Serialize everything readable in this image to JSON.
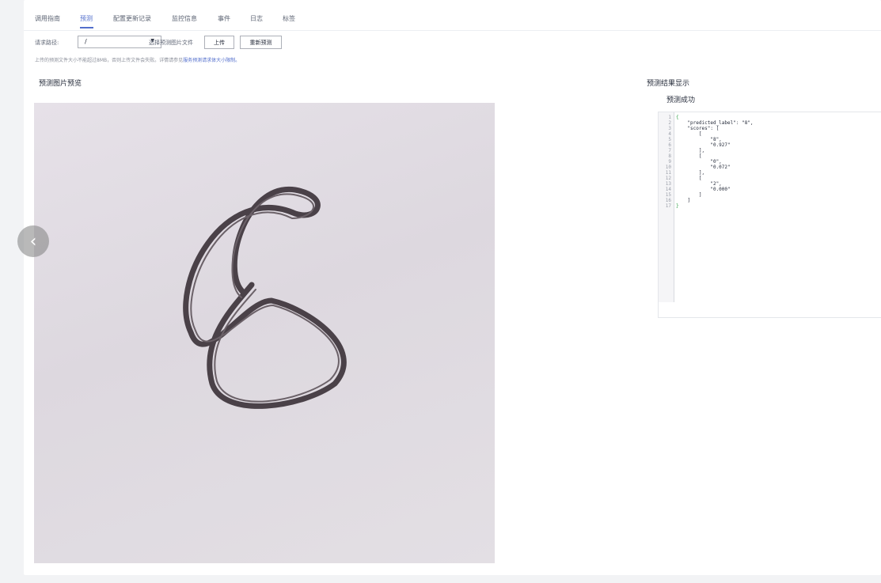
{
  "tabs": [
    "调用指南",
    "预测",
    "配置更新记录",
    "监控信息",
    "事件",
    "日志",
    "标签"
  ],
  "active_tab": "预测",
  "request": {
    "path_label": "请求路径:",
    "path_value": "/",
    "file_label": "选择预测图片文件",
    "upload_button": "上传",
    "repredict_button": "重新预测"
  },
  "hint": {
    "text": "上传的预测文件大小不能超过8MB，否则上传文件会失败。详情请参见",
    "link": "服务预测请求体大小限制。"
  },
  "preview": {
    "title": "预测图片预览",
    "image_content": "handwritten digit 8"
  },
  "result": {
    "title": "预测结果显示",
    "status": "预测成功",
    "line_numbers": [
      "1",
      "2",
      "3",
      "4",
      "5",
      "6",
      "7",
      "8",
      "9",
      "10",
      "11",
      "12",
      "13",
      "14",
      "15",
      "16",
      "17"
    ],
    "code_lines": [
      "{",
      "    \"predicted_label\": \"8\",",
      "    \"scores\": [",
      "        [",
      "            \"8\",",
      "            \"0.927\"",
      "        ],",
      "        [",
      "            \"0\",",
      "            \"0.072\"",
      "        ],",
      "        [",
      "            \"2\",",
      "            \"0.000\"",
      "        ]",
      "    ]",
      "}"
    ]
  },
  "colors": {
    "accent": "#526ecc",
    "json_bracket": "#37a24d"
  },
  "icons": {
    "prev": "chevron-left-icon",
    "dropdown": "caret-down-icon"
  }
}
